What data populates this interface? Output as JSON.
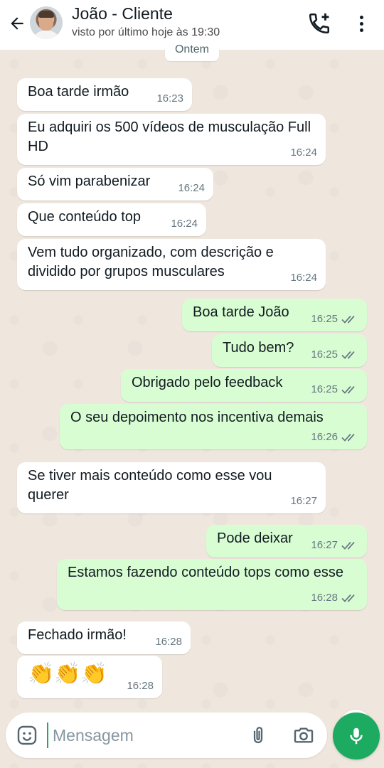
{
  "header": {
    "contact_name": "João - Cliente",
    "status": "visto por último hoje às 19:30",
    "icons": [
      "back-arrow-icon",
      "add-call-icon",
      "more-vertical-icon"
    ]
  },
  "chat": {
    "date_separator": "Ontem",
    "messages": [
      {
        "dir": "in",
        "text": "Boa tarde irmão",
        "time": "16:23"
      },
      {
        "dir": "in",
        "text": "Eu adquiri os 500 vídeos de musculação Full HD",
        "time": "16:24"
      },
      {
        "dir": "in",
        "text": "Só vim parabenizar",
        "time": "16:24"
      },
      {
        "dir": "in",
        "text": "Que conteúdo top",
        "time": "16:24"
      },
      {
        "dir": "in",
        "text": "Vem tudo organizado, com descrição e dividido por grupos musculares",
        "time": "16:24"
      },
      {
        "dir": "out",
        "text": "Boa tarde João",
        "time": "16:25",
        "status": "read"
      },
      {
        "dir": "out",
        "text": "Tudo bem?",
        "time": "16:25",
        "status": "read"
      },
      {
        "dir": "out",
        "text": "Obrigado pelo feedback",
        "time": "16:25",
        "status": "read"
      },
      {
        "dir": "out",
        "text": "O seu depoimento nos incentiva demais",
        "time": "16:26",
        "status": "read"
      },
      {
        "dir": "in",
        "text": "Se tiver mais conteúdo como esse vou querer",
        "time": "16:27"
      },
      {
        "dir": "out",
        "text": "Pode deixar",
        "time": "16:27",
        "status": "read"
      },
      {
        "dir": "out",
        "text": "Estamos fazendo conteúdo tops como esse",
        "time": "16:28",
        "status": "read"
      },
      {
        "dir": "in",
        "text": "Fechado irmão!",
        "time": "16:28"
      },
      {
        "dir": "in",
        "text": "👏👏👏",
        "time": "16:28"
      }
    ]
  },
  "composer": {
    "placeholder": "Mensagem",
    "icons": [
      "emoji-icon",
      "attach-icon",
      "camera-icon",
      "mic-icon"
    ]
  },
  "colors": {
    "header_bg": "#ffffff",
    "chat_bg": "#efe7de",
    "incoming_bubble": "#ffffff",
    "outgoing_bubble": "#d9fdd3",
    "accent_green": "#1daa61",
    "meta_text": "#667781"
  }
}
